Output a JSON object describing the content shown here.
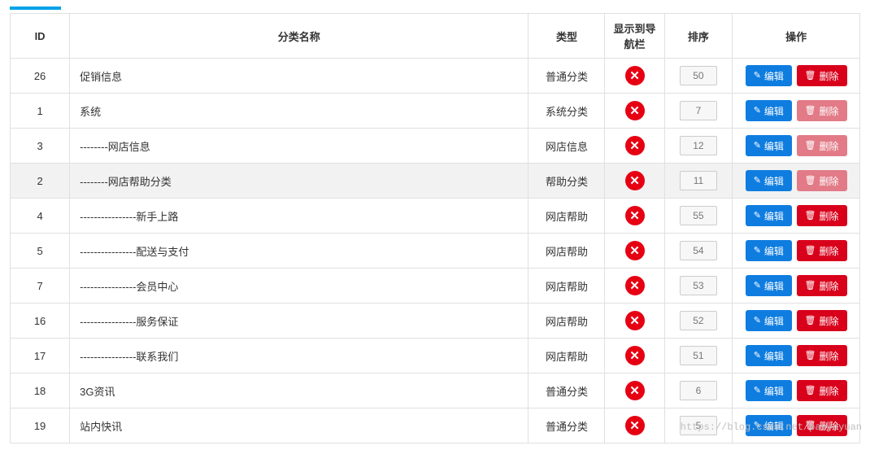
{
  "columns": {
    "id": "ID",
    "name": "分类名称",
    "type": "类型",
    "nav": "显示到导航栏",
    "sort": "排序",
    "ops": "操作"
  },
  "buttons": {
    "edit": "编辑",
    "del": "删除"
  },
  "rows": [
    {
      "id": "26",
      "name": "促销信息",
      "type": "普通分类",
      "nav": false,
      "sort": "50",
      "softDelete": false,
      "highlight": false
    },
    {
      "id": "1",
      "name": "系统",
      "type": "系统分类",
      "nav": false,
      "sort": "7",
      "softDelete": true,
      "highlight": false
    },
    {
      "id": "3",
      "name": "--------网店信息",
      "type": "网店信息",
      "nav": false,
      "sort": "12",
      "softDelete": true,
      "highlight": false
    },
    {
      "id": "2",
      "name": "--------网店帮助分类",
      "type": "帮助分类",
      "nav": false,
      "sort": "11",
      "softDelete": true,
      "highlight": true
    },
    {
      "id": "4",
      "name": "----------------新手上路",
      "type": "网店帮助",
      "nav": false,
      "sort": "55",
      "softDelete": false,
      "highlight": false
    },
    {
      "id": "5",
      "name": "----------------配送与支付",
      "type": "网店帮助",
      "nav": false,
      "sort": "54",
      "softDelete": false,
      "highlight": false
    },
    {
      "id": "7",
      "name": "----------------会员中心",
      "type": "网店帮助",
      "nav": false,
      "sort": "53",
      "softDelete": false,
      "highlight": false
    },
    {
      "id": "16",
      "name": "----------------服务保证",
      "type": "网店帮助",
      "nav": false,
      "sort": "52",
      "softDelete": false,
      "highlight": false
    },
    {
      "id": "17",
      "name": "----------------联系我们",
      "type": "网店帮助",
      "nav": false,
      "sort": "51",
      "softDelete": false,
      "highlight": false
    },
    {
      "id": "18",
      "name": "3G资讯",
      "type": "普通分类",
      "nav": false,
      "sort": "6",
      "softDelete": false,
      "highlight": false
    },
    {
      "id": "19",
      "name": "站内快讯",
      "type": "普通分类",
      "nav": false,
      "sort": "5",
      "softDelete": false,
      "highlight": false
    }
  ],
  "watermark": "https://blog.csdn.net/panyuyuan"
}
